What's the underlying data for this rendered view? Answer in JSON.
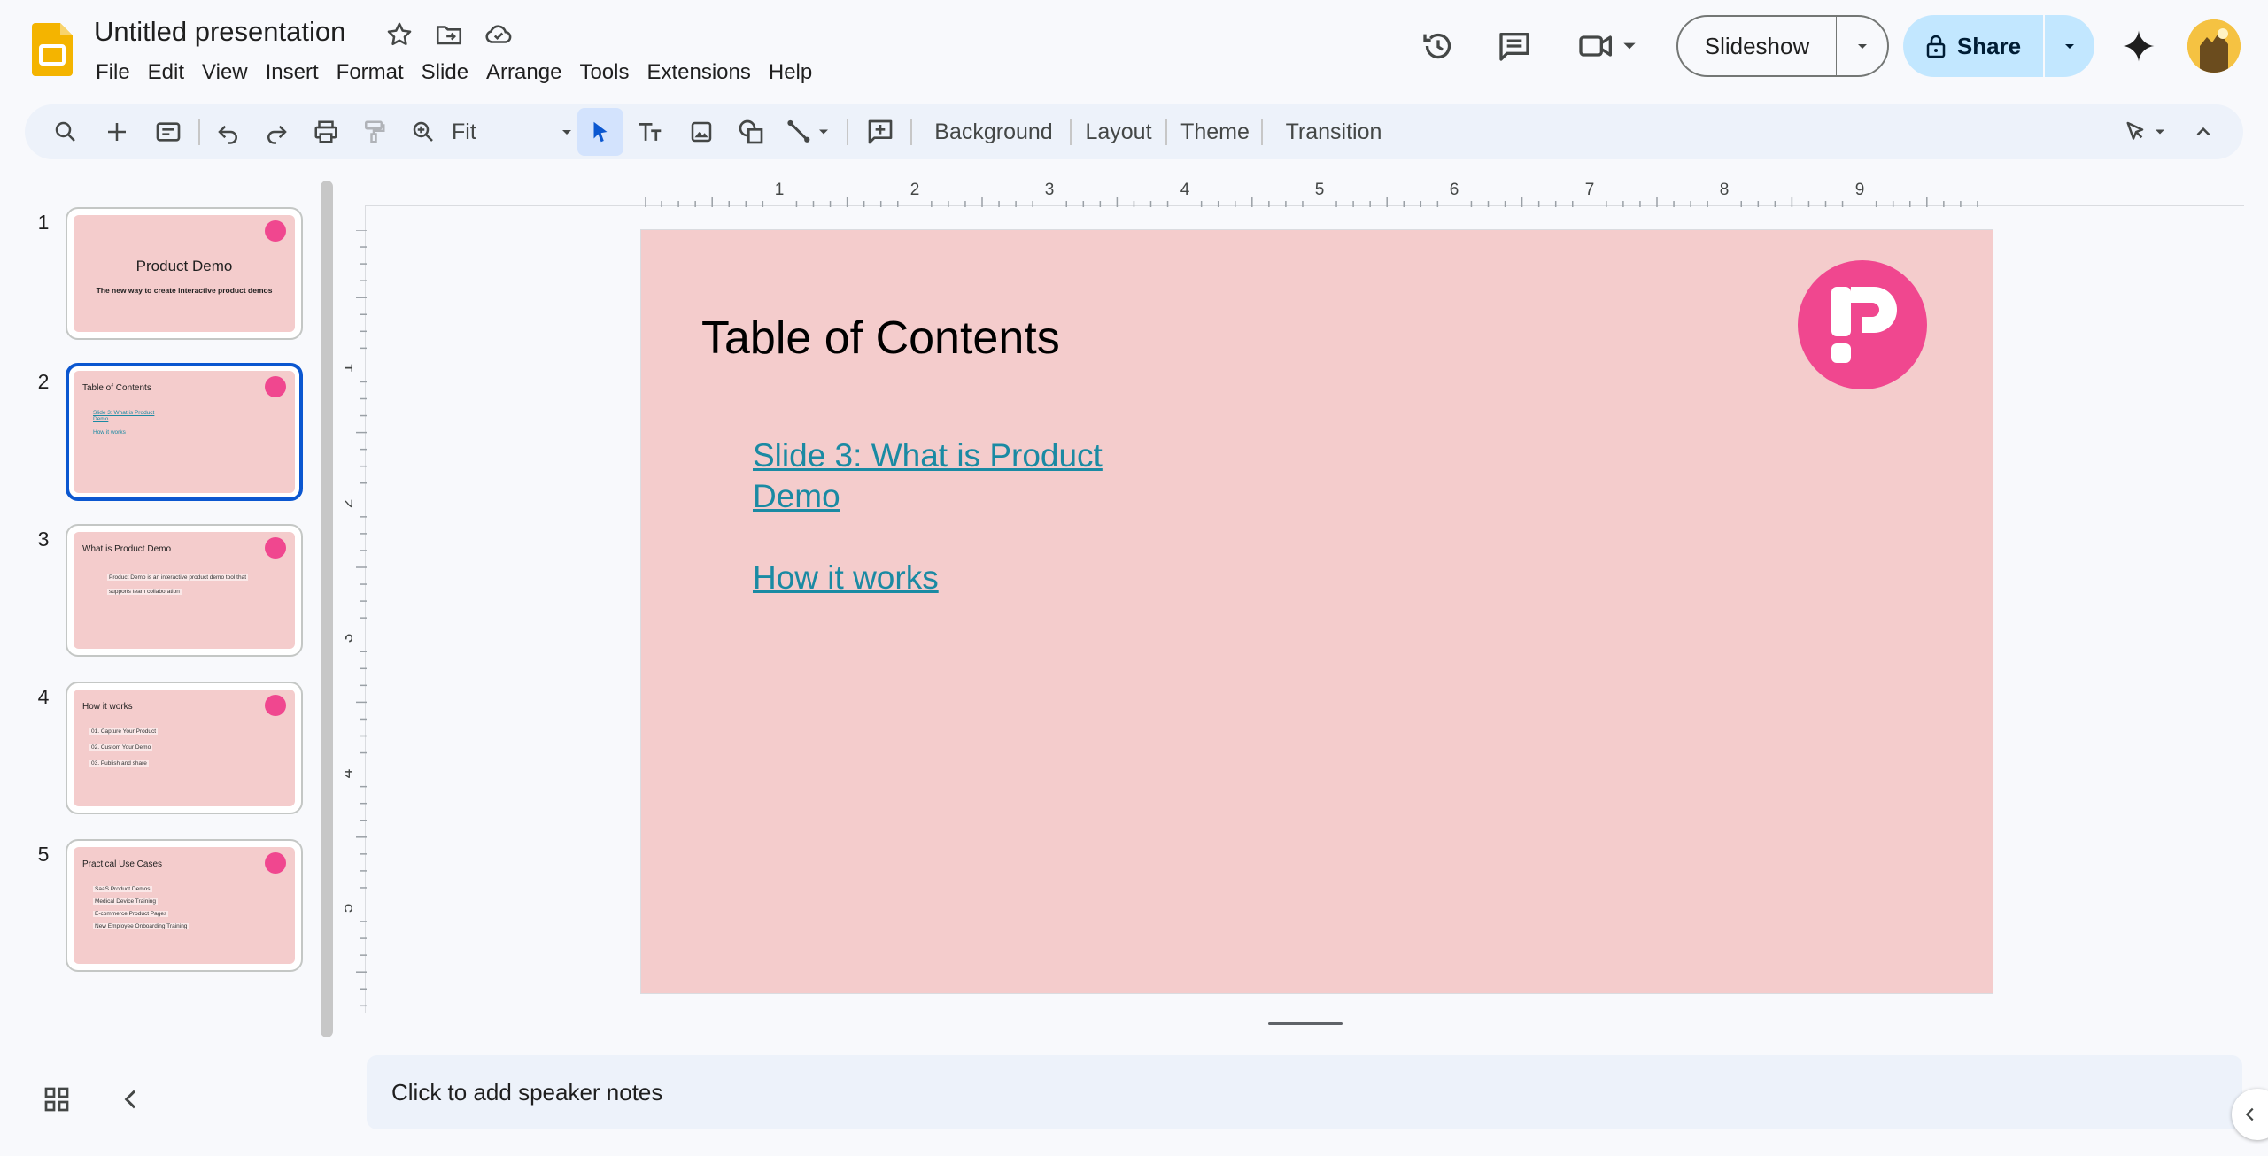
{
  "app": {
    "title": "Untitled presentation",
    "icon": "google-slides-logo"
  },
  "menu": [
    "File",
    "Edit",
    "View",
    "Insert",
    "Format",
    "Slide",
    "Arrange",
    "Tools",
    "Extensions",
    "Help"
  ],
  "header": {
    "slideshow_label": "Slideshow",
    "share_label": "Share"
  },
  "toolbar": {
    "zoom_label": "Fit",
    "background_label": "Background",
    "layout_label": "Layout",
    "theme_label": "Theme",
    "transition_label": "Transition"
  },
  "slides": [
    {
      "number": "1",
      "title": "Product Demo",
      "subtitle": "The new way to create interactive product demos"
    },
    {
      "number": "2",
      "title": "Table of Contents",
      "links": [
        "Slide 3: What is Product Demo",
        "How it works"
      ]
    },
    {
      "number": "3",
      "title": "What is Product Demo",
      "lines": [
        "Product Demo is an interactive product demo tool that",
        "supports team collaboration"
      ]
    },
    {
      "number": "4",
      "title": "How it works",
      "lines": [
        "01. Capture Your Product",
        "02. Custom Your Demo",
        "03. Publish and share"
      ]
    },
    {
      "number": "5",
      "title": "Practical Use Cases",
      "lines": [
        "SaaS Product Demos",
        "Medical Device Training",
        "E-commerce Product Pages",
        "New Employee Onboarding Training"
      ]
    }
  ],
  "selected_slide": 2,
  "ruler": {
    "horizontal": [
      "1",
      "2",
      "3",
      "4",
      "5",
      "6",
      "7",
      "8",
      "9"
    ],
    "vertical": [
      "1",
      "2",
      "3",
      "4",
      "5"
    ]
  },
  "current_slide": {
    "title": "Table of Contents",
    "link_1_line_1": "Slide 3: What is Product",
    "link_1_line_2": "Demo",
    "link_2": "How it works"
  },
  "notes_placeholder": "Click to add speaker notes",
  "colors": {
    "slide_bg": "#f4cccc",
    "link": "#1a8aa3",
    "logo": "#f0478f",
    "accent": "#0b57d0"
  }
}
